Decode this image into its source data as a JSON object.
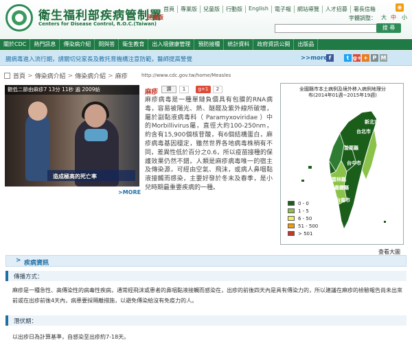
{
  "header": {
    "site_title": "衛生福利部疾病管制署",
    "edition": "民眾版",
    "site_subtitle": "Centers for Disease Control, R.O.C.(Taiwan)",
    "top_links": [
      "首頁",
      "專業版",
      "兒童版",
      "行動版",
      "English",
      "電子報",
      "網站導覽",
      "人才招募",
      "署長信箱"
    ],
    "font_size_label": "字體調整：",
    "font_sizes": [
      "大",
      "中",
      "小"
    ],
    "search_placeholder": "",
    "search_button": "搜 尋"
  },
  "main_nav": [
    "關於CDC",
    "熱門訊息",
    "傳染病介紹",
    "問與答",
    "衛生教育",
    "出入境健康管理",
    "預防接種",
    "統計資料",
    "政府資訊公開",
    "出版品"
  ],
  "notice": {
    "text": "腸病毒進入流行期，請關切兒家長及教托育機構注意防範，醫師提高警覺",
    "more": ">>more"
  },
  "social": [
    "f",
    "t",
    "g+",
    "+",
    "P",
    "M"
  ],
  "breadcrumb": [
    "首頁",
    "傳染病介紹",
    "傳染病介紹",
    "麻疹"
  ],
  "page_url": "http://www.cdc.gov.tw/home/Measles",
  "video": {
    "title": "觀低二節由麻疹7 13分 11秒 遍 2009紡",
    "caption": "造成極高的死亡率"
  },
  "more_link": ">MORE",
  "article": {
    "title": "麻疹",
    "like_label": "讚",
    "like_count": "1",
    "gplus_label": "g+1",
    "gplus_count": "2",
    "body": "麻疹病毒是一種單鏈負價具有包膜的RNA病毒，容易被陽光、熱、醚醛及紫外線所破壞，屬於副黏液病毒科（ Paramyxoviridae ）中的Morbillivirus屬，直徑大約100-250nm，約含有15,900個核苷酸，有6個結構蛋白，麻疹病毒基因穩定，雖然世界各地病毒株稍有不同，差異性低於百分之0.6，所以疫苗接種的保護效果仍然不錯。人類是麻疹病毒唯一的宿主及傳染源，可經由空氣、飛沫，或病人鼻咽黏液接觸而感染，主要好發於冬末及春季，是小兒時期最重要疾病的一種。"
  },
  "map": {
    "title_line1": "全國縣市本土病例及境外移入病例地理分",
    "title_line2": "布(2014年01週~2015年19週)",
    "labels": [
      "新北市",
      "台北市",
      "苗栗縣",
      "台中市",
      "雲林縣",
      "嘉義縣",
      "台南市"
    ],
    "legend": [
      {
        "label": "0 - 0",
        "color": "#1a5e1a"
      },
      {
        "label": "1 - 5",
        "color": "#8bc34a"
      },
      {
        "label": "6 - 50",
        "color": "#f1f160"
      },
      {
        "label": "51 - 500",
        "color": "#f39c12"
      },
      {
        "label": "> 501",
        "color": "#c0392b"
      }
    ],
    "enlarge": "查看大圖"
  },
  "section": {
    "title": "疾病資訊",
    "transmission_label": "傳播方式：",
    "transmission_text": "麻疹是一種急性、高傳染性的病毒性疾病，通常經飛沫或患者的鼻咽黏液接觸而感染在，出疹的前後四天內是具有傳染力的，所以建議在麻疹的檢驗報告尚未出來前或在出疹前後4天內，病患要採隔離措施，以避免傳染給沒有免疫力的人。",
    "incubation_label": "潛伏期：",
    "incubation_text": "以出疹日為計算基準，自感染至出疹約7-18天。"
  }
}
